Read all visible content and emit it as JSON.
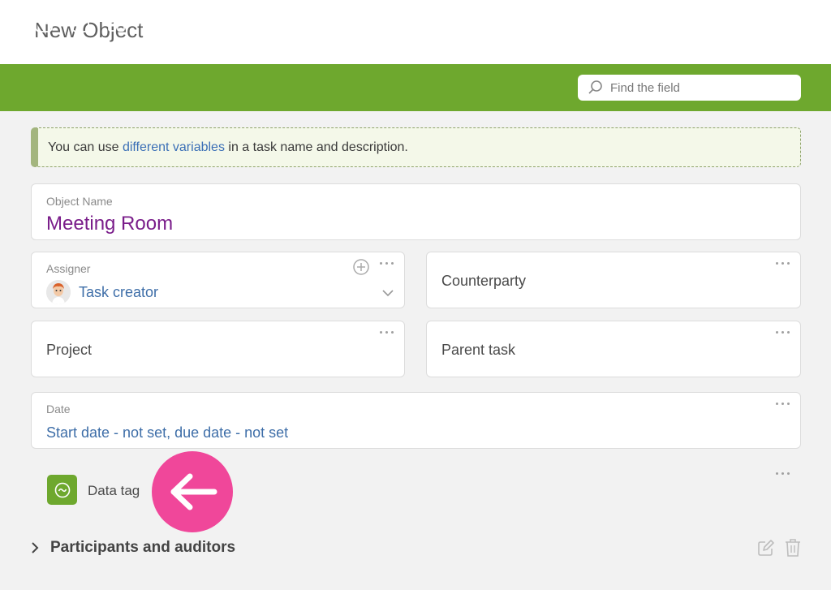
{
  "header": {
    "title": "New Object"
  },
  "toolbar": {
    "buttons": [
      {
        "icon": "add-field-icon"
      },
      {
        "icon": "layout-icon"
      },
      {
        "icon": "widgets-dropdown-icon"
      },
      {
        "icon": "template-dropdown-icon"
      }
    ],
    "search": {
      "placeholder": "Find the field"
    }
  },
  "notice": {
    "text_before": "You can use ",
    "link": "different variables",
    "text_after": " in a task name and description."
  },
  "object_name": {
    "label": "Object Name",
    "value": "Meeting Room"
  },
  "assigner": {
    "label": "Assigner",
    "value": "Task creator"
  },
  "counterparty": {
    "placeholder": "Counterparty"
  },
  "project": {
    "placeholder": "Project"
  },
  "parent_task": {
    "placeholder": "Parent task"
  },
  "date": {
    "label": "Date",
    "value": "Start date - not set, due date - not set"
  },
  "data_tag": {
    "label": "Data tag"
  },
  "participants": {
    "label": "Participants and auditors"
  },
  "colors": {
    "toolbar": "#6ea82e",
    "accent_link": "#3e6ea8",
    "name_value": "#7a1d8a",
    "callout": "#f0479a"
  }
}
